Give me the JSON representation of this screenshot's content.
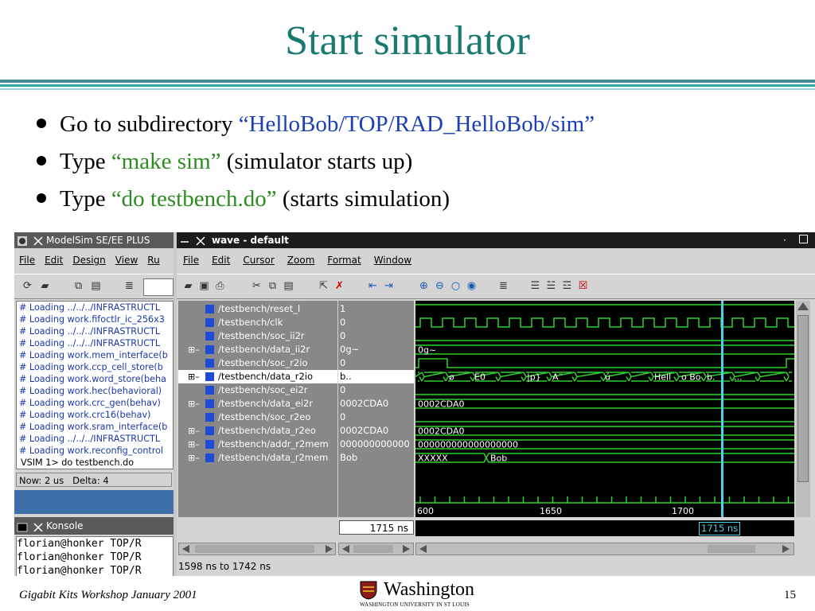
{
  "slide": {
    "title": "Start simulator",
    "bullets": [
      {
        "pre": "Go to subdirectory ",
        "quoted": "“HelloBob/TOP/RAD_HelloBob/sim”",
        "post": "",
        "style": "blue"
      },
      {
        "pre": "Type ",
        "quoted": "“make sim”",
        "post": " (simulator starts up)",
        "style": "green"
      },
      {
        "pre": "Type ",
        "quoted": "“do testbench.do”",
        "post": " (starts simulation)",
        "style": "green"
      }
    ],
    "footer_left": "Gigabit Kits Workshop January 2001",
    "page_number": "15",
    "logo_name": "Washington",
    "logo_sub": "WASHINGTON UNIVERSITY IN ST LOUIS"
  },
  "modelsim": {
    "title": "ModelSim SE/EE PLUS",
    "menu": [
      "File",
      "Edit",
      "Design",
      "View",
      "Ru"
    ],
    "log": [
      "# Loading ../../../INFRASTRUCTL",
      "# Loading work.fifoctlr_ic_256x3",
      "# Loading ../../../INFRASTRUCTL",
      "# Loading ../../../INFRASTRUCTL",
      "# Loading work.mem_interface(b",
      "# Loading work.ccp_cell_store(b",
      "# Loading work.word_store(beha",
      "# Loading work.hec(behavioral)",
      "# Loading work.crc_gen(behav)",
      "# Loading work.crc16(behav)",
      "# Loading work.sram_interface(b",
      "# Loading ../../../INFRASTRUCTL",
      "# Loading work.reconfig_control"
    ],
    "prompt": "VSIM 1> do testbench.do",
    "status_now": "Now: 2 us",
    "status_delta": "Delta: 4"
  },
  "konsole": {
    "title": "Konsole",
    "lines": [
      "florian@honker TOP/R",
      "florian@honker TOP/R",
      "florian@honker TOP/R"
    ]
  },
  "wave": {
    "title": "wave - default",
    "menu": [
      "File",
      "Edit",
      "Cursor",
      "Zoom",
      "Format",
      "Window"
    ],
    "signals": [
      {
        "name": "/testbench/reset_l",
        "value": "1",
        "expand": false
      },
      {
        "name": "/testbench/clk",
        "value": "0",
        "expand": false
      },
      {
        "name": "/testbench/soc_ii2r",
        "value": "0",
        "expand": false
      },
      {
        "name": "/testbench/data_ii2r",
        "value": "0g~",
        "expand": true
      },
      {
        "name": "/testbench/soc_r2io",
        "value": "0",
        "expand": false
      },
      {
        "name": "/testbench/data_r2io",
        "value": "b..",
        "expand": true,
        "selected": true
      },
      {
        "name": "/testbench/soc_ei2r",
        "value": "0",
        "expand": false
      },
      {
        "name": "/testbench/data_ei2r",
        "value": "0002CDA0",
        "expand": true
      },
      {
        "name": "/testbench/soc_r2eo",
        "value": "0",
        "expand": false
      },
      {
        "name": "/testbench/data_r2eo",
        "value": "0002CDA0",
        "expand": true
      },
      {
        "name": "/testbench/addr_r2mem",
        "value": "000000000000",
        "expand": true
      },
      {
        "name": "/testbench/data_r2mem",
        "value": "Bob",
        "expand": true
      }
    ],
    "bus_labels": {
      "data_ii2r": "0g~",
      "data_r2io": [
        "ø",
        "E0",
        "|p}",
        "A¨",
        "ú",
        "Hell",
        "o Bo",
        "b.",
        "..."
      ],
      "data_ei2r": "0002CDA0",
      "data_r2eo": "0002CDA0",
      "addr_r2mem": "000000000000000000",
      "data_r2mem_a": "XXXXX",
      "data_r2mem_b": "Bob"
    },
    "axis_ticks": [
      "600",
      "1650",
      "1700"
    ],
    "cursor_time": "1715 ns",
    "cursor_readout": "1715 ns",
    "range": "1598 ns to 1742 ns",
    "colors": {
      "wave": "#2fd02f",
      "cursor": "#4fd0e8",
      "bus_text": "#ffffff"
    }
  }
}
